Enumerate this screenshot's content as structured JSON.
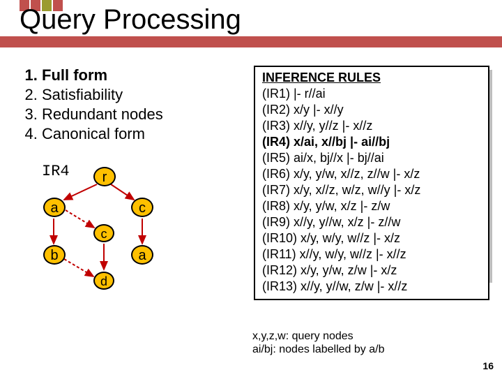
{
  "title": "Query Processing",
  "list": {
    "i1": "Full form",
    "i2": "Satisfiability",
    "i3": "Redundant nodes",
    "i4": "Canonical form"
  },
  "diagram": {
    "label": "IR4",
    "r": "r",
    "a": "a",
    "c1": "c",
    "c2": "c",
    "b": "b",
    "a2": "a",
    "d": "d"
  },
  "rules": {
    "header": "INFERENCE RULES",
    "r1": "(IR1) |- r//ai",
    "r2": "(IR2) x/y |- x//y",
    "r3": "(IR3) x//y, y//z |- x//z",
    "r4": "(IR4) x/ai, x//bj |- ai//bj",
    "r5": "(IR5) ai/x, bj//x |- bj//ai",
    "r6": "(IR6) x/y, y/w, x//z, z//w |- x/z",
    "r7": "(IR7) x/y, x//z, w/z, w//y |- x/z",
    "r8": "(IR8) x/y, y/w, x/z |- z/w",
    "r9": "(IR9) x//y, y//w, x/z |- z//w",
    "r10": "(IR10) x/y, w/y, w//z |- x/z",
    "r11": "(IR11) x//y, w/y, w//z |- x//z",
    "r12": "(IR12) x/y, y/w, z/w |- x/z",
    "r13": "(IR13) x//y, y//w, z/w |- x//z"
  },
  "footnote": {
    "l1": "x,y,z,w: query nodes",
    "l2": "ai/bj: nodes labelled by a/b"
  },
  "pagenum": "16"
}
